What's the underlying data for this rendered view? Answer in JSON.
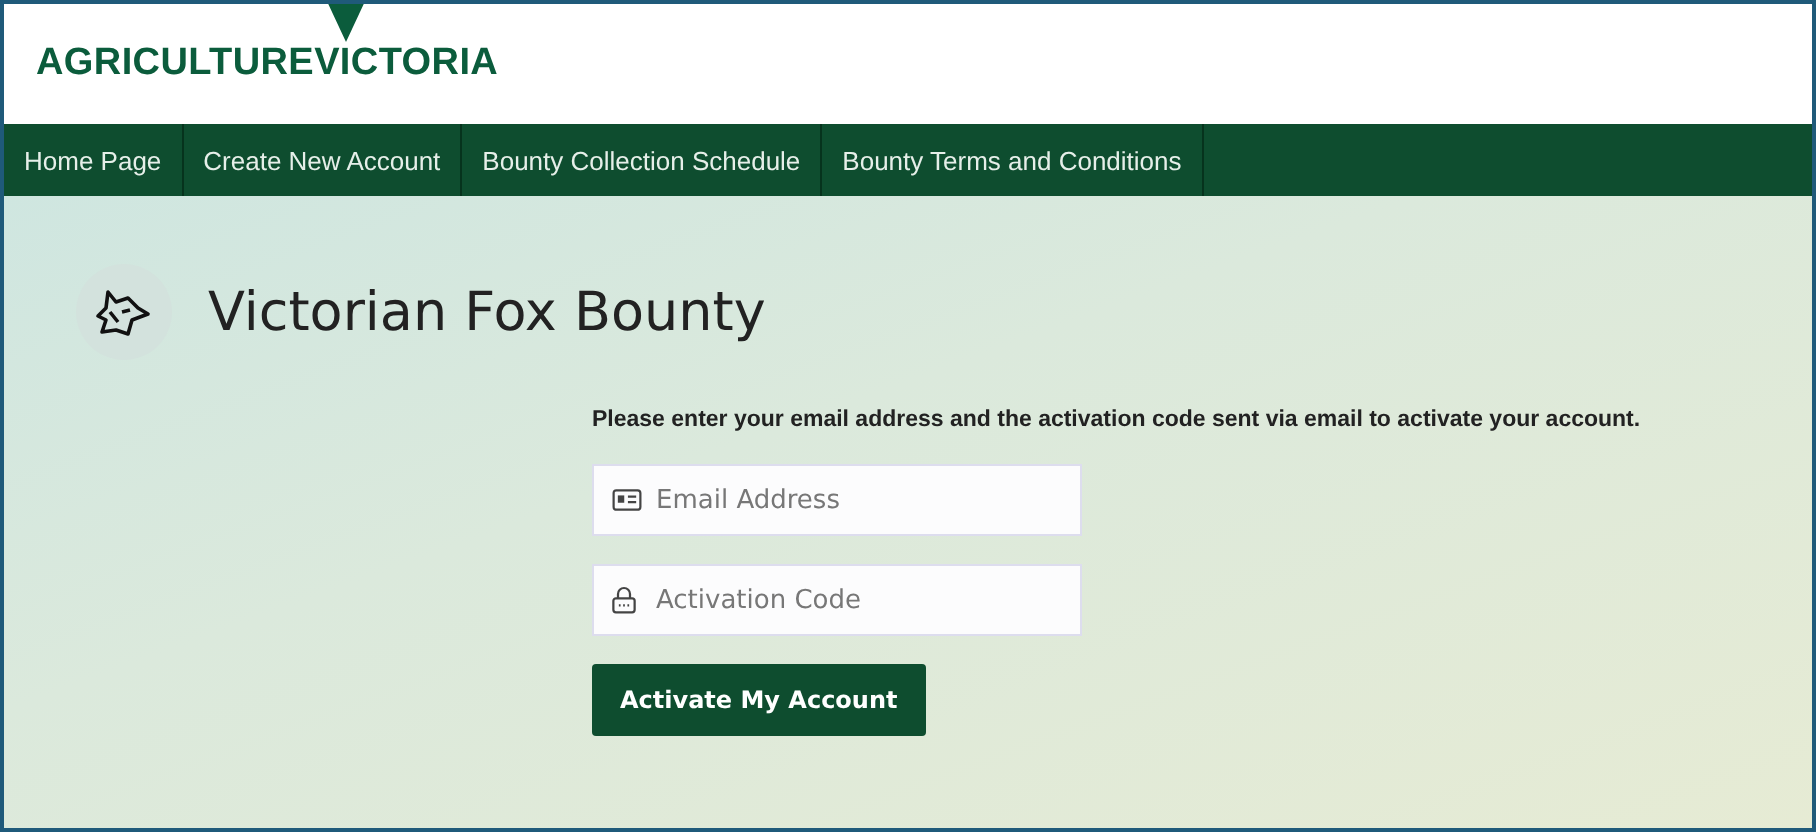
{
  "logo": {
    "word_1": "AGRICULTURE",
    "word_2": "VICTORIA"
  },
  "nav": [
    {
      "label": "Home Page"
    },
    {
      "label": "Create New Account"
    },
    {
      "label": "Bounty Collection Schedule"
    },
    {
      "label": "Bounty Terms and Conditions"
    }
  ],
  "page_title": "Victorian Fox Bounty",
  "instructions": "Please enter your email address and the activation code sent via email to activate your account.",
  "fields": [
    {
      "kind": "email",
      "placeholder": "Email Address"
    },
    {
      "kind": "code",
      "placeholder": "Activation Code"
    }
  ],
  "submit_button": "Activate My Account"
}
